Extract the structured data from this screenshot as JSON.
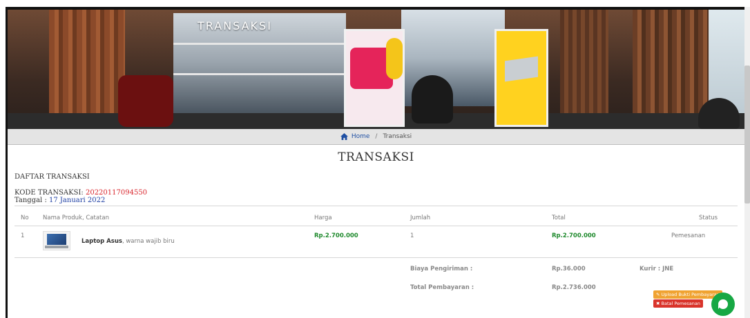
{
  "hero": {
    "title": "TRANSAKSI"
  },
  "breadcrumb": {
    "home": "Home",
    "separator": "/",
    "current": "Transaksi"
  },
  "page": {
    "title": "TRANSAKSI",
    "section": "DAFTAR TRANSAKSI"
  },
  "transaction": {
    "code_label": "KODE TRANSAKSI: ",
    "code": "20220117094550",
    "date_label": "Tanggal : ",
    "date": "17 Januari 2022"
  },
  "table": {
    "headers": {
      "no": "No",
      "product": "Nama Produk, Catatan",
      "price": "Harga",
      "qty": "Jumlah",
      "total": "Total",
      "status": "Status"
    },
    "rows": [
      {
        "no": "1",
        "product": "Laptop Asus",
        "note": ", warna wajib biru",
        "price": "Rp.2.700.000",
        "qty": "1",
        "total": "Rp.2.700.000",
        "status": "Pemesanan"
      }
    ]
  },
  "summary": {
    "shipping_label": "Biaya Pengiriman :",
    "shipping_value": "Rp.36.000",
    "courier": "Kurir : JNE",
    "total_label": "Total Pembayaran :",
    "total_value": "Rp.2.736.000"
  },
  "actions": {
    "upload": "Upload Bukti Pembayaran",
    "cancel": "Batal Pemesanan"
  },
  "icons": {
    "home": "home-icon",
    "upload": "edit-icon",
    "cancel": "close-icon",
    "chat": "chat-icon"
  },
  "colors": {
    "accent_red": "#d9252c",
    "link_blue": "#1e4fa3",
    "price_green": "#1f8a2d",
    "upload_orange": "#f0a332",
    "cancel_red": "#d9342b",
    "chat_green": "#17a844"
  }
}
